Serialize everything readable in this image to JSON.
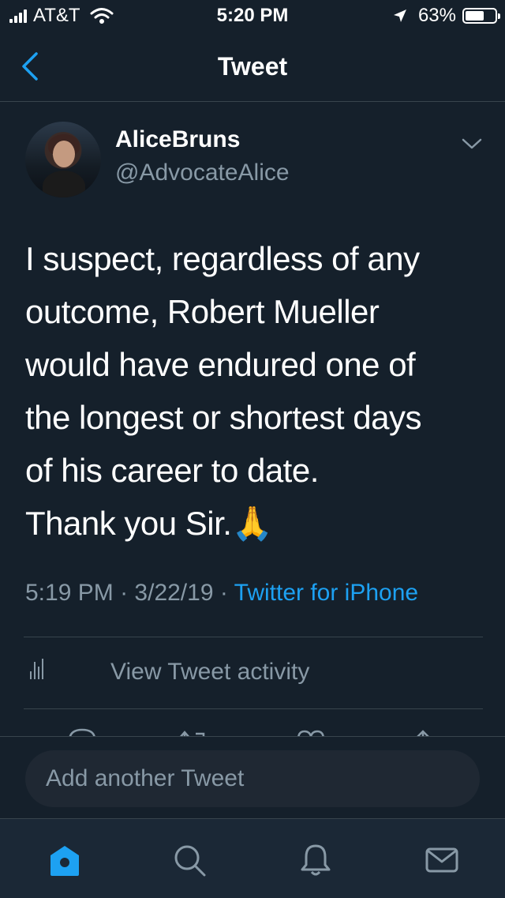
{
  "status_bar": {
    "carrier": "AT&T",
    "time": "5:20 PM",
    "battery": "63%",
    "battery_level": 0.63
  },
  "header": {
    "title": "Tweet",
    "back_icon": "chevron-left-icon"
  },
  "tweet": {
    "display_name": "AliceBruns",
    "handle": "@AdvocateAlice",
    "text": "I suspect, regardless of any\noutcome, Robert Mueller\nwould have endured one of\nthe longest or shortest days\nof his career to date.\nThank you Sir.🙏",
    "time": "5:19 PM",
    "date": "3/22/19",
    "separator": "·",
    "source": "Twitter for iPhone",
    "activity_label": "View Tweet activity"
  },
  "compose": {
    "placeholder": "Add another Tweet"
  },
  "tab_bar": {
    "items": [
      "home-icon",
      "search-icon",
      "notifications-icon",
      "messages-icon"
    ]
  },
  "colors": {
    "background": "#15202b",
    "accent": "#1da1f2",
    "secondary_text": "#8899a6",
    "divider": "#38444d"
  }
}
